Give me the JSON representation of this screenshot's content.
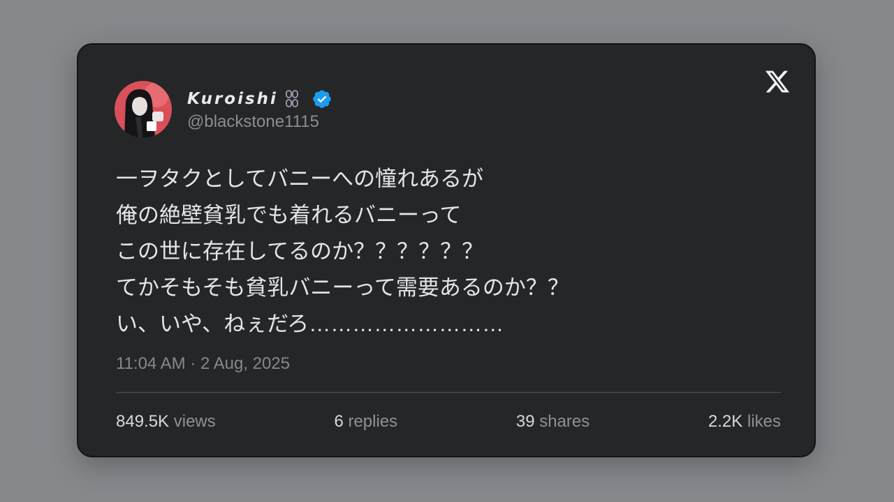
{
  "tweet": {
    "author": {
      "display_name": "Kuroishi",
      "name_decoration": "chain-icon",
      "handle": "@blackstone1115",
      "verified": true,
      "verified_color": "#1d9bf0"
    },
    "lines": [
      "一ヲタクとしてバニーへの憧れあるが",
      "俺の絶壁貧乳でも着れるバニーって",
      "この世に存在してるのか？？？？？？",
      "てかそもそも貧乳バニーって需要あるのか？？",
      "い、いや、ねぇだろ………………………"
    ],
    "timestamp": "11:04 AM · 2 Aug, 2025",
    "stats": {
      "views": {
        "value": "849.5K",
        "label": "views"
      },
      "replies": {
        "value": "6",
        "label": "replies"
      },
      "shares": {
        "value": "39",
        "label": "shares"
      },
      "likes": {
        "value": "2.2K",
        "label": "likes"
      }
    }
  },
  "brand_icon": "x-logo-icon",
  "colors": {
    "background": "#85898c",
    "card": "#252628",
    "text": "#e4e5e6",
    "muted": "#8b8e92"
  }
}
